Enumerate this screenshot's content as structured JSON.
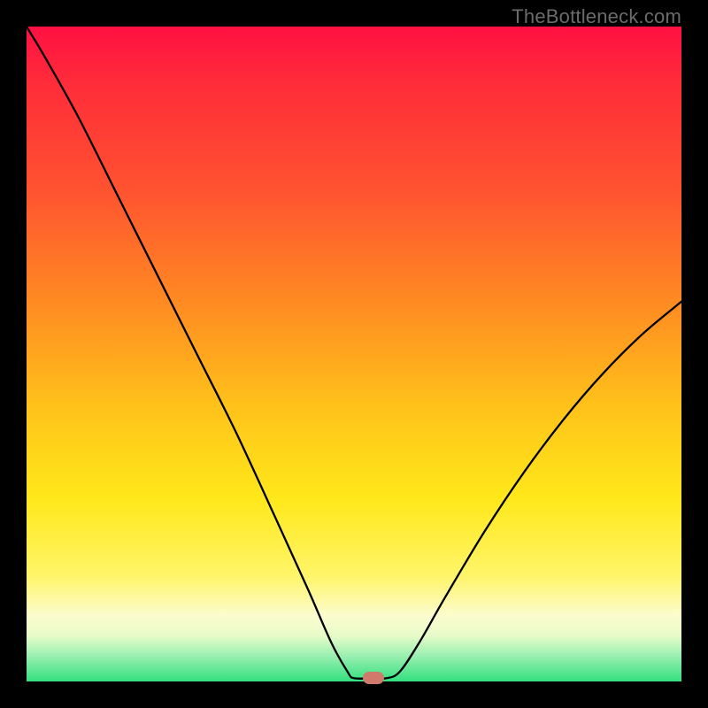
{
  "watermark": "TheBottleneck.com",
  "colors": {
    "frame": "#000000",
    "curve": "#000000",
    "marker": "#cf7a6a",
    "gradient_stops": [
      "#ff1043",
      "#ff2a3a",
      "#ff5330",
      "#ff8a22",
      "#ffc21a",
      "#ffe81a",
      "#fff56a",
      "#fcfccf",
      "#e8fbc8",
      "#9cf0b1",
      "#33e07f"
    ]
  },
  "chart_data": {
    "type": "line",
    "title": "",
    "xlabel": "",
    "ylabel": "",
    "x_range": [
      0,
      100
    ],
    "y_range": [
      0,
      100
    ],
    "categories_note": "x is relative horizontal position 0–100 (plot width); y is bottleneck % 0–100 (plot height, 0 at bottom)",
    "series": [
      {
        "name": "bottleneck-curve",
        "points": [
          {
            "x": 0.0,
            "y": 100.0
          },
          {
            "x": 3.0,
            "y": 95.0
          },
          {
            "x": 8.0,
            "y": 86.0
          },
          {
            "x": 14.0,
            "y": 74.0
          },
          {
            "x": 20.0,
            "y": 62.0
          },
          {
            "x": 26.0,
            "y": 50.0
          },
          {
            "x": 32.0,
            "y": 38.0
          },
          {
            "x": 38.0,
            "y": 25.0
          },
          {
            "x": 43.0,
            "y": 14.0
          },
          {
            "x": 46.5,
            "y": 6.0
          },
          {
            "x": 49.0,
            "y": 1.5
          },
          {
            "x": 50.0,
            "y": 0.5
          },
          {
            "x": 53.0,
            "y": 0.5
          },
          {
            "x": 55.0,
            "y": 0.5
          },
          {
            "x": 57.0,
            "y": 1.5
          },
          {
            "x": 60.0,
            "y": 6.0
          },
          {
            "x": 64.0,
            "y": 13.0
          },
          {
            "x": 70.0,
            "y": 23.0
          },
          {
            "x": 76.0,
            "y": 32.0
          },
          {
            "x": 82.0,
            "y": 40.0
          },
          {
            "x": 88.0,
            "y": 47.0
          },
          {
            "x": 94.0,
            "y": 53.0
          },
          {
            "x": 100.0,
            "y": 58.0
          }
        ]
      }
    ],
    "marker": {
      "x": 53.0,
      "y": 0.5
    }
  }
}
